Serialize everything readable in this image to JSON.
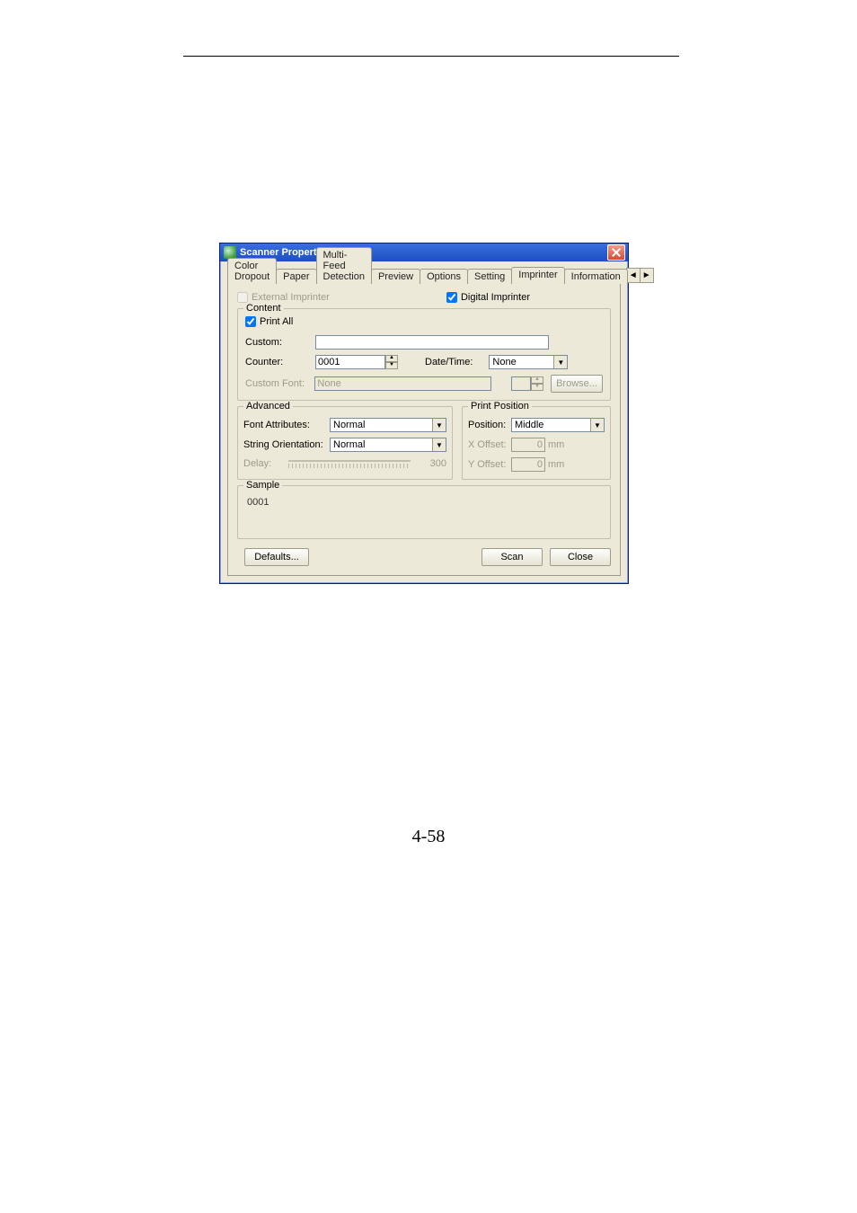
{
  "page": {
    "number": "4-58"
  },
  "window": {
    "title": "Scanner Properties"
  },
  "tabs": {
    "items": [
      "Color Dropout",
      "Paper",
      "Multi-Feed Detection",
      "Preview",
      "Options",
      "Setting",
      "Imprinter",
      "Information"
    ],
    "selected": "Imprinter",
    "scroll_left": "◄",
    "scroll_right": "►"
  },
  "imprinter": {
    "external_label": "External Imprinter",
    "external_checked": false,
    "digital_label": "Digital Imprinter",
    "digital_checked": true,
    "content": {
      "legend": "Content",
      "print_all_label": "Print All",
      "print_all_checked": true,
      "custom_label": "Custom:",
      "custom_value": "",
      "counter_label": "Counter:",
      "counter_value": "0001",
      "date_time_label": "Date/Time:",
      "date_time_value": "None",
      "custom_font_label": "Custom Font:",
      "custom_font_value": "None",
      "browse_label": "Browse..."
    },
    "advanced": {
      "legend": "Advanced",
      "font_attr_label": "Font Attributes:",
      "font_attr_value": "Normal",
      "orientation_label": "String Orientation:",
      "orientation_value": "Normal",
      "delay_label": "Delay:",
      "delay_value": "300"
    },
    "print_position": {
      "legend": "Print Position",
      "position_label": "Position:",
      "position_value": "Middle",
      "x_offset_label": "X Offset:",
      "x_offset_value": "0",
      "y_offset_label": "Y Offset:",
      "y_offset_value": "0",
      "unit": "mm"
    },
    "sample": {
      "legend": "Sample",
      "value": "0001"
    },
    "buttons": {
      "defaults": "Defaults...",
      "scan": "Scan",
      "close": "Close"
    }
  }
}
